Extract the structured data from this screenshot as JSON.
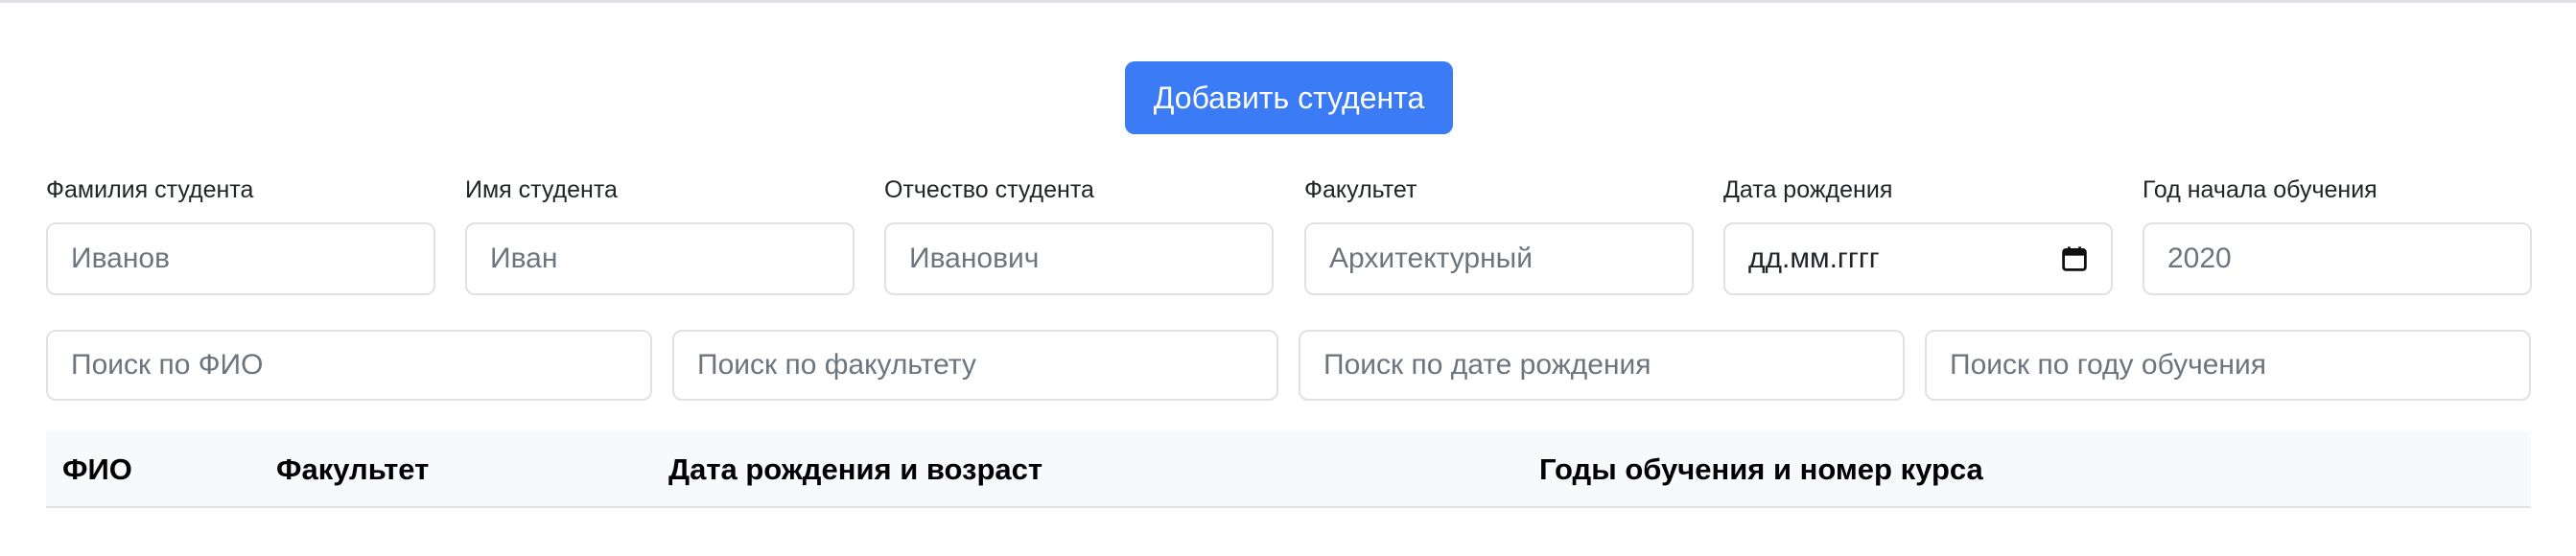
{
  "add_button_label": "Добавить студента",
  "form": {
    "fields": [
      {
        "label": "Фамилия студента",
        "placeholder": "Иванов"
      },
      {
        "label": "Имя студента",
        "placeholder": "Иван"
      },
      {
        "label": "Отчество студента",
        "placeholder": "Иванович"
      },
      {
        "label": "Факультет",
        "placeholder": "Архитектурный"
      },
      {
        "label": "Дата рождения",
        "placeholder": "дд.мм.гггг"
      },
      {
        "label": "Год начала обучения",
        "placeholder": "2020"
      }
    ]
  },
  "search": {
    "fio_placeholder": "Поиск по ФИО",
    "faculty_placeholder": "Поиск по факультету",
    "birthdate_placeholder": "Поиск по дате рождения",
    "year_placeholder": "Поиск по году обучения"
  },
  "table": {
    "columns": [
      "ФИО",
      "Факультет",
      "Дата рождения и возраст",
      "Годы обучения и номер курса"
    ],
    "rows": []
  },
  "colors": {
    "primary": "#3b7bf5",
    "border": "#dee2e6",
    "header_bg": "#f8f9fa"
  },
  "icons": {
    "date_picker": "calendar-icon"
  }
}
